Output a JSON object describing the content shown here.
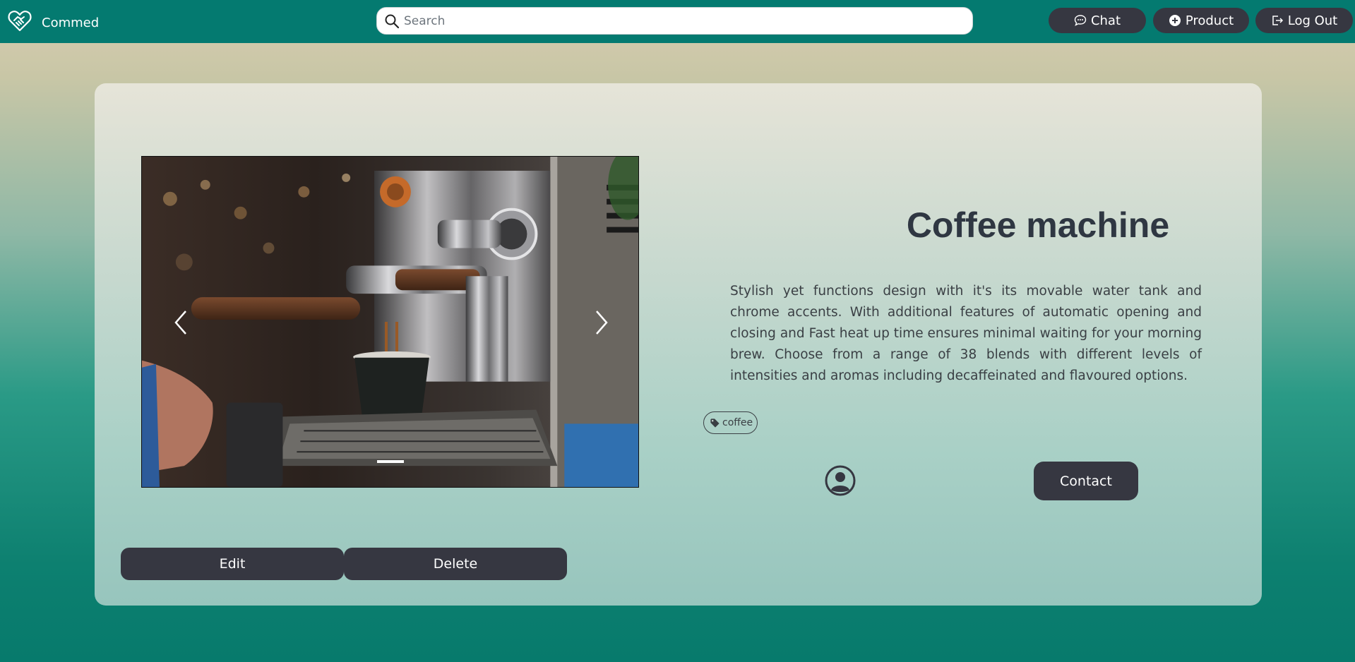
{
  "navbar": {
    "brand_name": "Commed",
    "search_placeholder": "Search",
    "chat_label": "Chat",
    "product_label": "Product",
    "logout_label": "Log Out",
    "bg_color": "#047a70",
    "button_color": "#363741"
  },
  "product": {
    "title": "Coffee machine",
    "description": "Stylish yet functions design with it's its movable water tank and chrome accents. With additional features of automatic opening and closing and Fast heat up time ensures minimal waiting for your morning brew. Choose from a range of 38 blends with different levels of intensities and aromas including decaffeinated and flavoured options.",
    "tags": [
      "coffee"
    ],
    "contact_label": "Contact",
    "edit_label": "Edit",
    "delete_label": "Delete"
  },
  "icons": {
    "brand": "heart-handshake-icon",
    "search": "search-icon",
    "chat": "chat-bubble-icon",
    "product": "plus-circle-icon",
    "logout": "logout-icon",
    "tag": "tag-icon",
    "avatar": "user-circle-icon"
  }
}
